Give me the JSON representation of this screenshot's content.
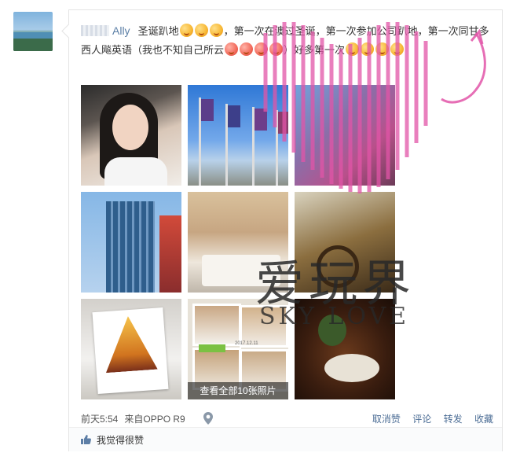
{
  "post": {
    "username": "Ally",
    "text_parts": [
      "圣诞趴地",
      "，第一次在澳过圣诞，第一次参加公司趴地，第一次同甘多西人飚英语（我也不知自己所云",
      "）好多第一次"
    ],
    "more_photos_label": "查看全部10张照片"
  },
  "meta": {
    "time": "前天5:54",
    "source": "来自OPPO R9",
    "actions": [
      "取消赞",
      "评论",
      "转发",
      "收藏"
    ]
  },
  "likes": {
    "label": "我觉得很赞"
  },
  "watermark": {
    "main": "爱玩界",
    "sub": "SKY LOVE"
  },
  "photos": {
    "ph8_date": "2017.12.11"
  },
  "colors": {
    "link": "#4d6e96",
    "username": "#5b7fa6",
    "heart": "#e255a8"
  }
}
